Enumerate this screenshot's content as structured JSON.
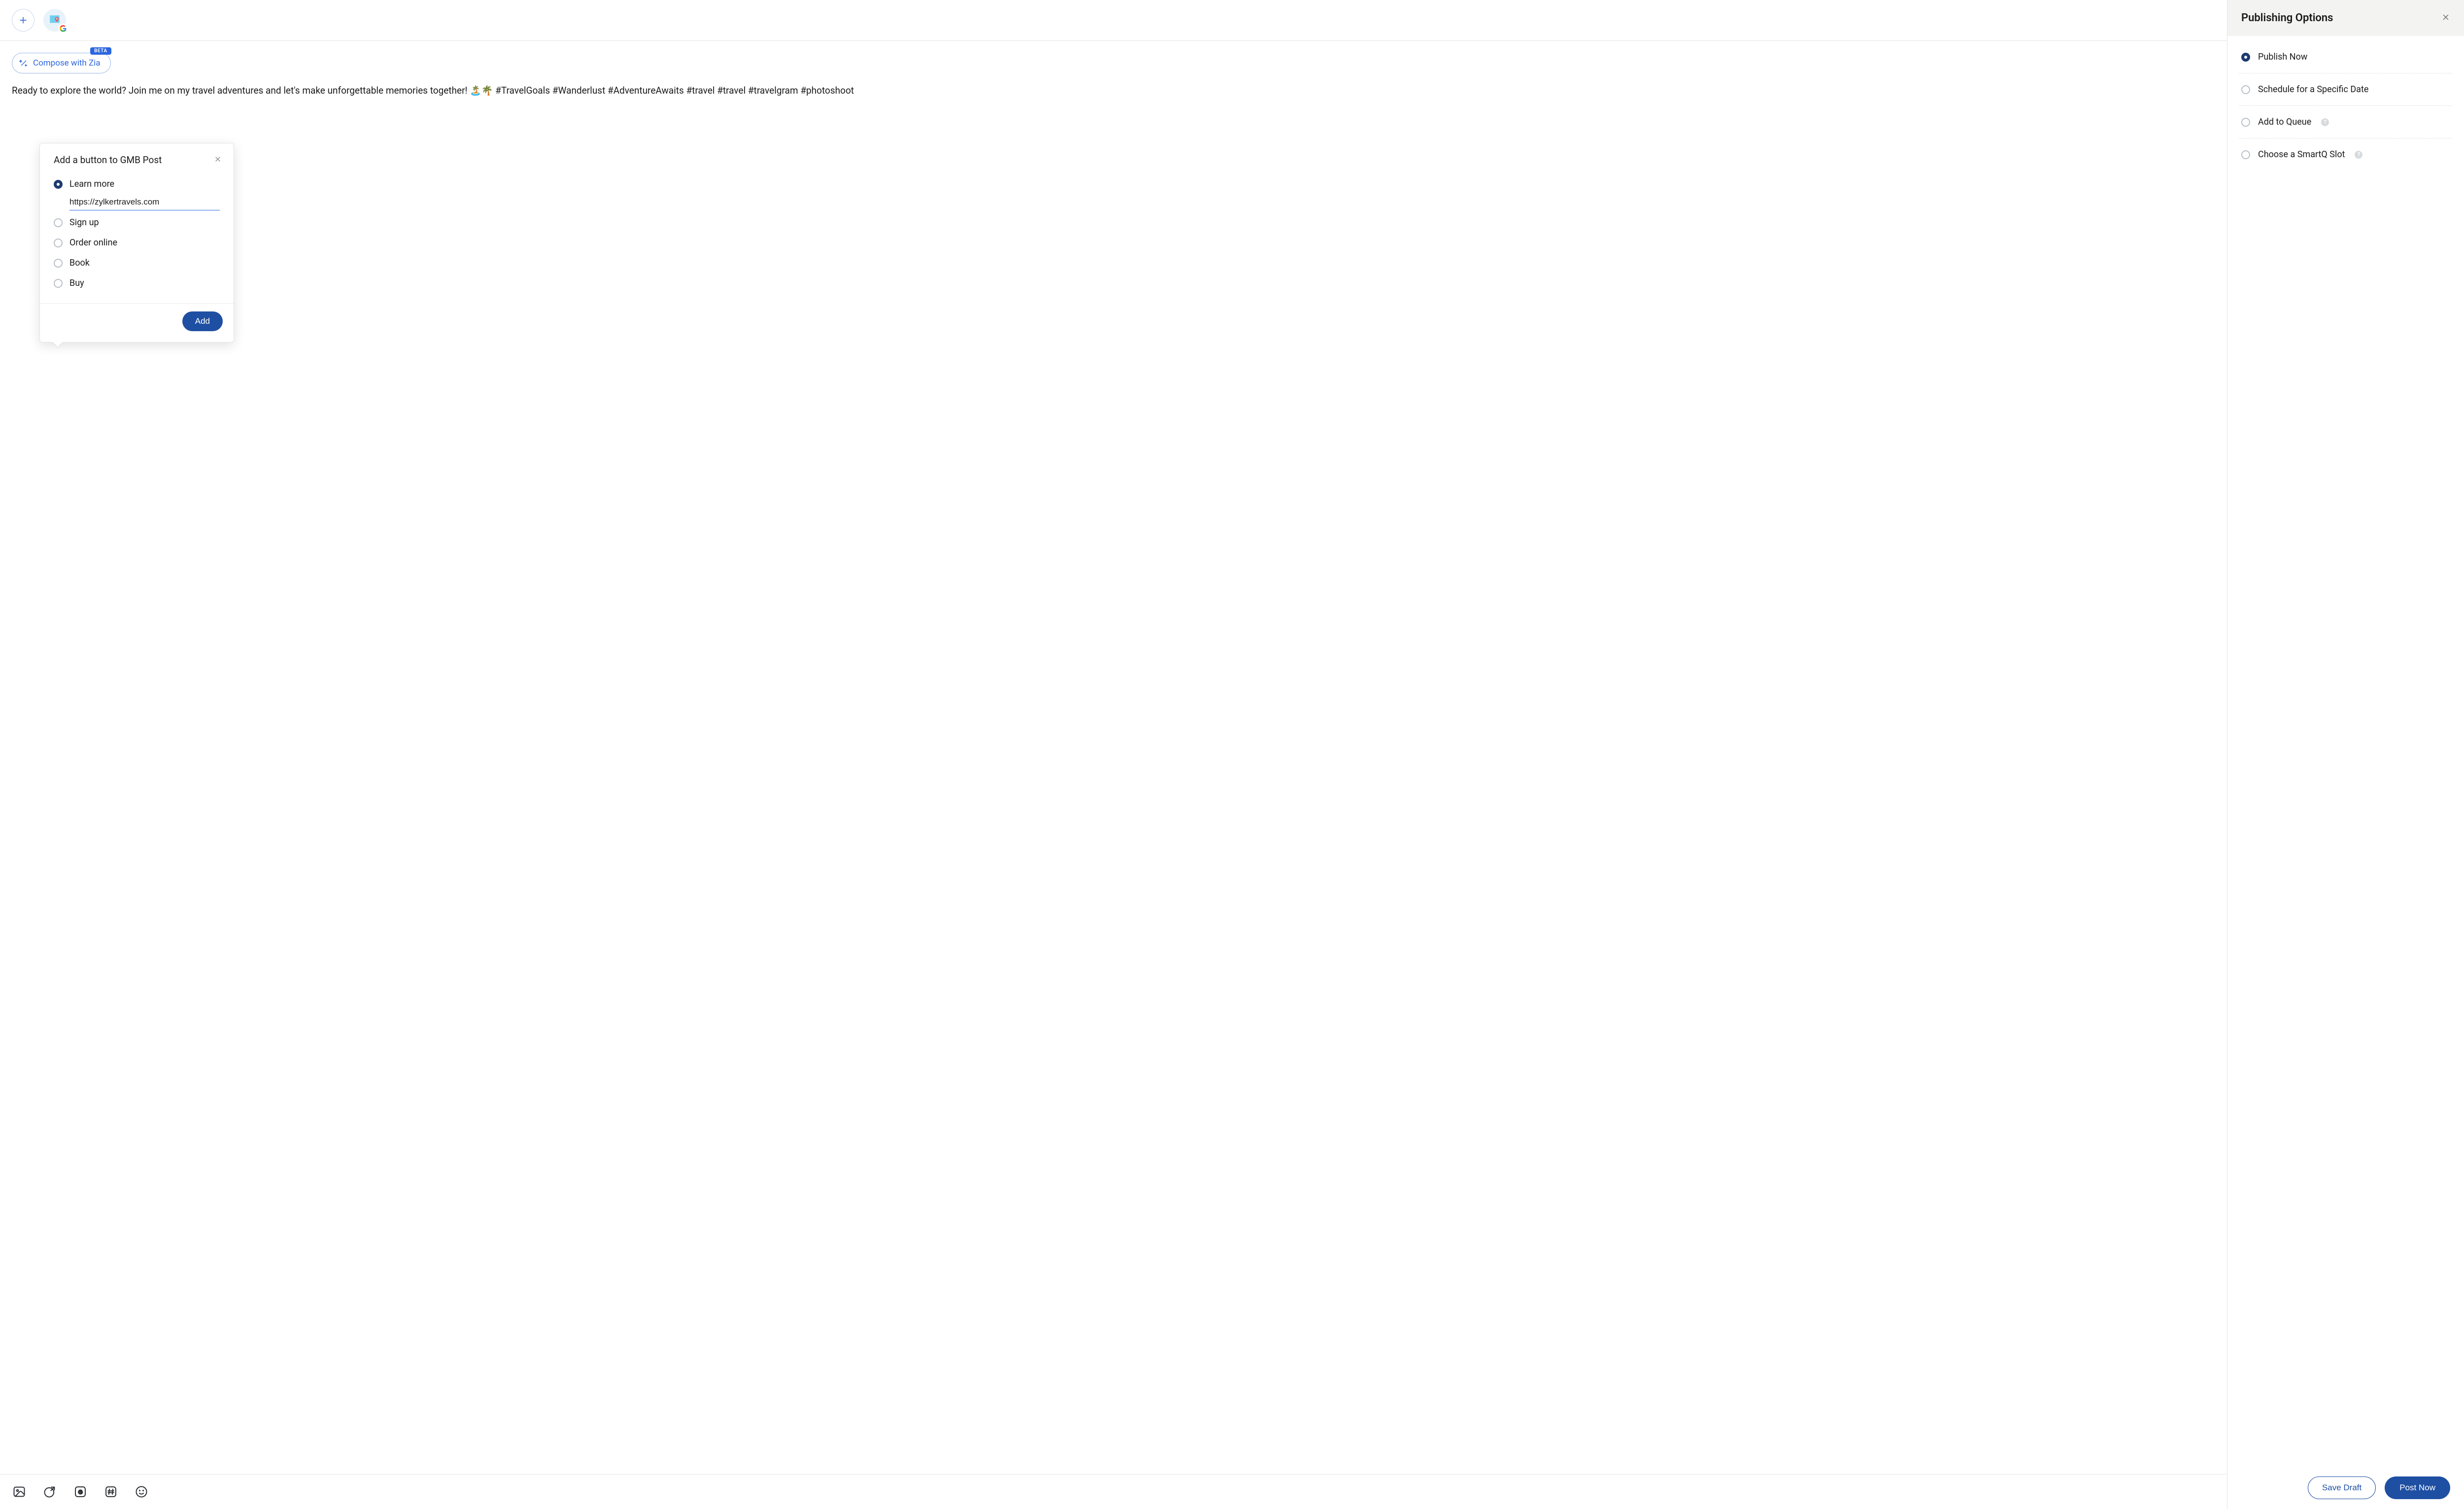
{
  "topbar": {
    "add_label": "Add channel"
  },
  "compose": {
    "zia_label": "Compose with Zia",
    "beta_badge": "BETA",
    "post_text": "Ready to explore the world? Join me on my travel adventures and let's make unforgettable memories together! 🏝️🌴 #TravelGoals #Wanderlust #AdventureAwaits #travel  #travel #travelgram #photoshoot"
  },
  "gmb_popover": {
    "title": "Add a button to GMB Post",
    "selected_index": 0,
    "url_value": "https://zylkertravels.com",
    "options": [
      "Learn more",
      "Sign up",
      "Order online",
      "Book",
      "Buy"
    ],
    "add_label": "Add"
  },
  "sidebar": {
    "title": "Publishing Options",
    "selected_index": 0,
    "options": [
      {
        "label": "Publish Now",
        "help": false
      },
      {
        "label": "Schedule for a Specific Date",
        "help": false
      },
      {
        "label": "Add to Queue",
        "help": true
      },
      {
        "label": "Choose a SmartQ Slot",
        "help": true
      }
    ]
  },
  "footer": {
    "save_draft": "Save Draft",
    "post_now": "Post Now"
  }
}
